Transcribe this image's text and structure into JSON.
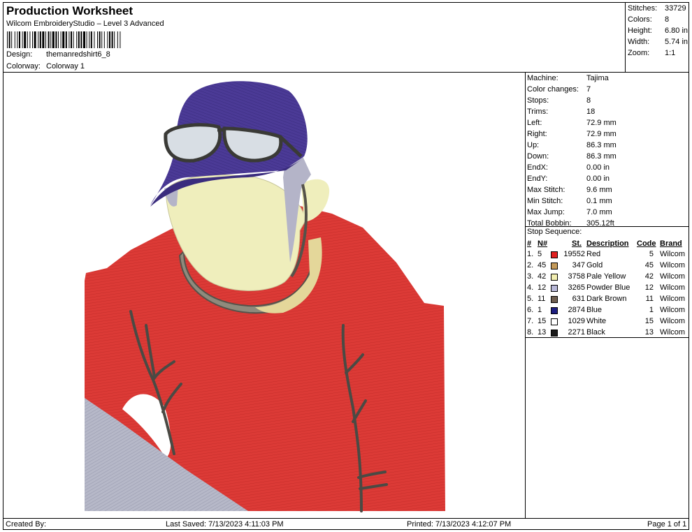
{
  "header": {
    "title": "Production Worksheet",
    "subtitle": "Wilcom EmbroideryStudio – Level 3 Advanced",
    "design_label": "Design:",
    "design_value": "themanredshirt6_8",
    "colorway_label": "Colorway:",
    "colorway_value": "Colorway 1"
  },
  "stats": [
    {
      "label": "Stitches:",
      "value": "33729"
    },
    {
      "label": "Colors:",
      "value": "8"
    },
    {
      "label": "Height:",
      "value": "6.80 in"
    },
    {
      "label": "Width:",
      "value": "5.74 in"
    },
    {
      "label": "Zoom:",
      "value": "1:1"
    }
  ],
  "machine": [
    {
      "label": "Machine:",
      "value": "Tajima"
    },
    {
      "label": "Color changes:",
      "value": "7"
    },
    {
      "label": "Stops:",
      "value": "8"
    },
    {
      "label": "Trims:",
      "value": "18"
    },
    {
      "label": "Left:",
      "value": "72.9 mm"
    },
    {
      "label": "Right:",
      "value": "72.9 mm"
    },
    {
      "label": "Up:",
      "value": "86.3 mm"
    },
    {
      "label": "Down:",
      "value": "86.3 mm"
    },
    {
      "label": "EndX:",
      "value": "0.00 in"
    },
    {
      "label": "EndY:",
      "value": "0.00 in"
    },
    {
      "label": "Max Stitch:",
      "value": "9.6 mm"
    },
    {
      "label": "Min Stitch:",
      "value": "0.1 mm"
    },
    {
      "label": "Max Jump:",
      "value": "7.0 mm"
    },
    {
      "label": "Total Bobbin:",
      "value": "305.12ft"
    }
  ],
  "stop_sequence": {
    "label": "Stop Sequence:",
    "headers": {
      "num": "#",
      "n": "N#",
      "st": "St.",
      "desc": "Description",
      "code": "Code",
      "brand": "Brand"
    },
    "rows": [
      {
        "num": "1.",
        "n": "5",
        "color": "#e02020",
        "st": "19552",
        "desc": "Red",
        "code": "5",
        "brand": "Wilcom"
      },
      {
        "num": "2.",
        "n": "45",
        "color": "#c49a5a",
        "st": "347",
        "desc": "Gold",
        "code": "45",
        "brand": "Wilcom"
      },
      {
        "num": "3.",
        "n": "42",
        "color": "#f2eeb0",
        "st": "3758",
        "desc": "Pale Yellow",
        "code": "42",
        "brand": "Wilcom"
      },
      {
        "num": "4.",
        "n": "12",
        "color": "#b8b8d8",
        "st": "3265",
        "desc": "Powder Blue",
        "code": "12",
        "brand": "Wilcom"
      },
      {
        "num": "5.",
        "n": "11",
        "color": "#6e5e50",
        "st": "631",
        "desc": "Dark Brown",
        "code": "11",
        "brand": "Wilcom"
      },
      {
        "num": "6.",
        "n": "1",
        "color": "#1e1e80",
        "st": "2874",
        "desc": "Blue",
        "code": "1",
        "brand": "Wilcom"
      },
      {
        "num": "7.",
        "n": "15",
        "color": "#ffffff",
        "st": "1029",
        "desc": "White",
        "code": "15",
        "brand": "Wilcom"
      },
      {
        "num": "8.",
        "n": "13",
        "color": "#1a1a1a",
        "st": "2271",
        "desc": "Black",
        "code": "13",
        "brand": "Wilcom"
      }
    ]
  },
  "footer": {
    "created": "Created By:",
    "saved": "Last Saved: 7/13/2023 4:11:03 PM",
    "printed": "Printed: 7/13/2023 4:12:07 PM",
    "page": "Page 1 of 1"
  },
  "colors": {
    "shirt": "#dc3a36",
    "cap": "#4b3a96",
    "face": "#efeebc",
    "collar": "#8f8a7c",
    "tan": "#e4d79a",
    "grey_panel": "#aeb0c2",
    "branch": "#4a4a44"
  }
}
